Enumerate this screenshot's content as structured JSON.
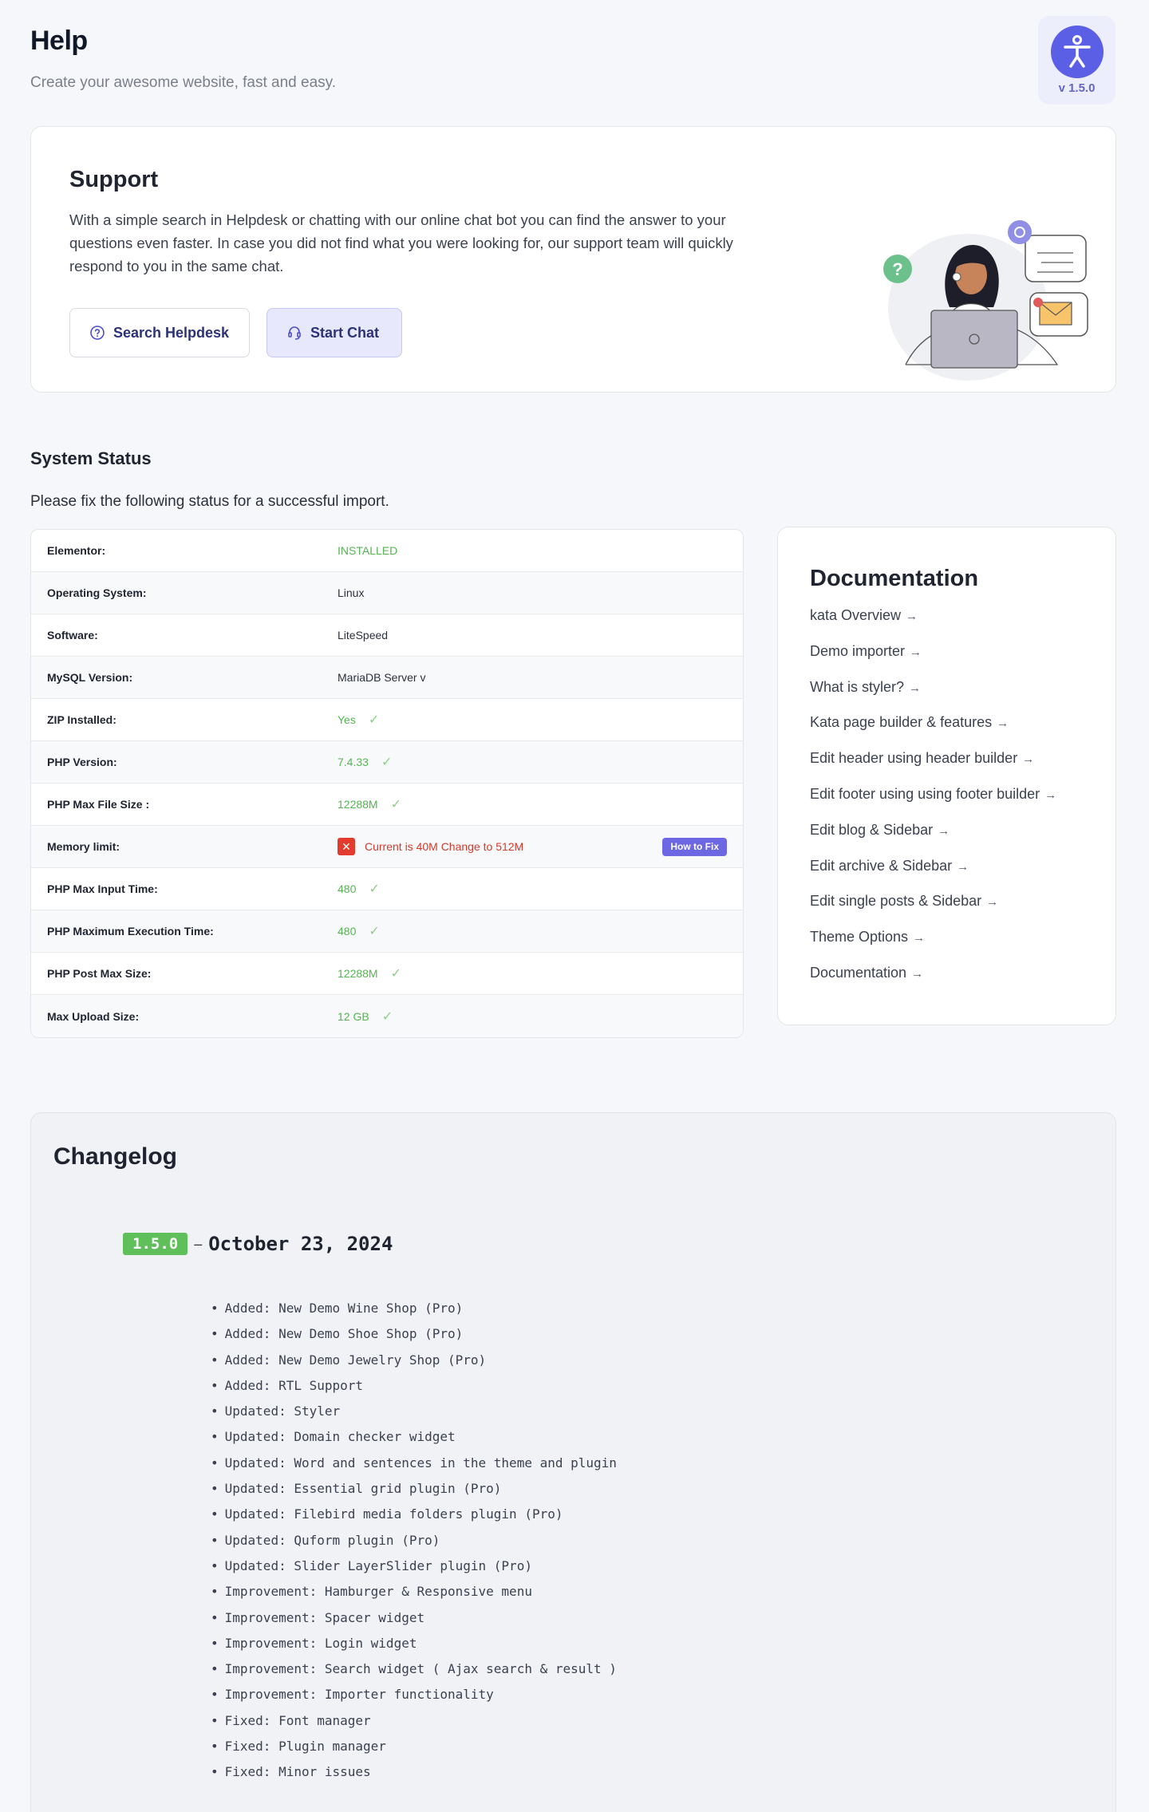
{
  "header": {
    "title": "Help",
    "subtitle": "Create your awesome website, fast and easy.",
    "version": "v 1.5.0"
  },
  "support": {
    "title": "Support",
    "text": "With a simple search in Helpdesk or chatting with our online chat bot you can find the answer to your questions even faster. In case you did not find what you were looking for, our support team will quickly respond to you in the same chat.",
    "search_label": "Search Helpdesk",
    "chat_label": "Start Chat"
  },
  "system_status": {
    "title": "System Status",
    "subtitle": "Please fix the following status for a successful import.",
    "how_to_fix": "How to Fix",
    "rows": [
      {
        "label": "Elementor:",
        "value": "INSTALLED",
        "state": "ok-nocheck"
      },
      {
        "label": "Operating System:",
        "value": "Linux",
        "state": "plain"
      },
      {
        "label": "Software:",
        "value": "LiteSpeed",
        "state": "plain"
      },
      {
        "label": "MySQL Version:",
        "value": "MariaDB Server v",
        "state": "plain"
      },
      {
        "label": "ZIP Installed:",
        "value": "Yes",
        "state": "ok"
      },
      {
        "label": "PHP Version:",
        "value": "7.4.33",
        "state": "ok"
      },
      {
        "label": "PHP Max File Size :",
        "value": "12288M",
        "state": "ok"
      },
      {
        "label": "Memory limit:",
        "value": "Current is 40M Change to 512M",
        "state": "error"
      },
      {
        "label": "PHP Max Input Time:",
        "value": "480",
        "state": "ok"
      },
      {
        "label": "PHP Maximum Execution Time:",
        "value": "480",
        "state": "ok"
      },
      {
        "label": "PHP Post Max Size:",
        "value": "12288M",
        "state": "ok"
      },
      {
        "label": "Max Upload Size:",
        "value": "12 GB",
        "state": "ok"
      }
    ]
  },
  "documentation": {
    "title": "Documentation",
    "links": [
      "kata Overview",
      "Demo importer",
      "What is styler?",
      "Kata page builder & features",
      "Edit header using header builder",
      "Edit footer using using footer builder",
      "Edit blog & Sidebar",
      "Edit archive & Sidebar",
      "Edit single posts & Sidebar",
      "Theme Options",
      "Documentation"
    ]
  },
  "changelog": {
    "title": "Changelog",
    "version": "1.5.0",
    "dash": "–",
    "date": "October 23, 2024",
    "items": [
      "Added: New Demo Wine Shop (Pro)",
      "Added: New Demo Shoe Shop (Pro)",
      "Added: New Demo Jewelry Shop (Pro)",
      "Added: RTL Support",
      "Updated: Styler",
      "Updated: Domain checker widget",
      "Updated: Word and sentences in the theme and plugin",
      "Updated: Essential grid plugin (Pro)",
      "Updated: Filebird media folders plugin (Pro)",
      "Updated: Quform plugin (Pro)",
      "Updated: Slider LayerSlider plugin (Pro)",
      "Improvement: Hamburger & Responsive menu",
      "Improvement: Spacer widget",
      "Improvement: Login widget",
      "Improvement: Search widget ( Ajax search & result )",
      "Improvement: Importer functionality",
      "Fixed: Font manager",
      "Fixed: Plugin manager",
      "Fixed: Minor issues"
    ]
  },
  "colors": {
    "accent": "#5a5fe6",
    "ok": "#58b354",
    "error": "#d23a2c",
    "release_badge": "#5fbf5a"
  }
}
